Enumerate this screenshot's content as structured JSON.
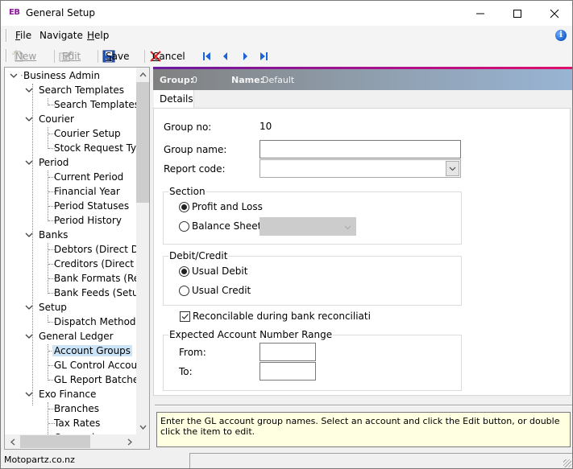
{
  "window": {
    "logo": "EB",
    "title": "General Setup",
    "controls": [
      "minimize",
      "maximize",
      "close"
    ]
  },
  "menu": {
    "items": [
      {
        "label": "File",
        "mnemonic": "F"
      },
      {
        "label": "Navigate",
        "mnemonic": ""
      },
      {
        "label": "Help",
        "mnemonic": "H"
      }
    ],
    "info_icon": "info-icon"
  },
  "toolbar": {
    "new_label": "New",
    "edit_label": "Edit",
    "save_label": "Save",
    "cancel_label": "Cancel",
    "nav": [
      "first-record",
      "previous-record",
      "next-record",
      "last-record"
    ],
    "brand_blue": "#1a64d8",
    "cancel_red": "#e02020"
  },
  "tree": {
    "root": "Business Admin",
    "groups": [
      {
        "label": "Search Templates",
        "children": [
          "Search Templates"
        ]
      },
      {
        "label": "Courier",
        "children": [
          "Courier Setup",
          "Stock Request Type"
        ]
      },
      {
        "label": "Period",
        "children": [
          "Current Period",
          "Financial Year",
          "Period Statuses",
          "Period History"
        ]
      },
      {
        "label": "Banks",
        "children": [
          "Debtors (Direct Debit",
          "Creditors (Direct Cr",
          "Bank Formats (Reco",
          "Bank Feeds (Setup A"
        ]
      },
      {
        "label": "Setup",
        "children": [
          "Dispatch Methods"
        ]
      },
      {
        "label": "General Ledger",
        "children": [
          "Account Groups",
          "GL Control Account",
          "GL Report Batches"
        ]
      },
      {
        "label": "Exo Finance",
        "children": [
          "Branches",
          "Tax Rates",
          "Currencies"
        ]
      }
    ],
    "selected": "Account Groups",
    "selected_color": "#cce4f7"
  },
  "header": {
    "group_label": "Group:",
    "group_value": "0",
    "name_label": "Name:",
    "name_value": "Default"
  },
  "tabs": [
    {
      "label": "Details",
      "active": true
    }
  ],
  "form": {
    "group_no_label": "Group no:",
    "group_no_value": "10",
    "group_name_label": "Group name:",
    "group_name_value": "",
    "report_code_label": "Report code:",
    "report_code_value": "",
    "section": {
      "title": "Section",
      "options": [
        {
          "label": "Profit and Loss",
          "checked": true
        },
        {
          "label": "Balance Sheet",
          "checked": false
        }
      ],
      "balance_sheet_combo_value": ""
    },
    "debit_credit": {
      "title": "Debit/Credit",
      "options": [
        {
          "label": "Usual Debit",
          "checked": true
        },
        {
          "label": "Usual Credit",
          "checked": false
        }
      ]
    },
    "reconcilable": {
      "label": "Reconcilable during bank reconciliati",
      "checked": true
    },
    "range": {
      "title": "Expected Account Number Range",
      "from_label": "From:",
      "from_value": "",
      "to_label": "To:",
      "to_value": ""
    }
  },
  "hint": "Enter the GL account group names. Select an account and click the Edit button, or double click the item to edit.",
  "status": {
    "left": "Motopartz.co.nz",
    "right": ""
  }
}
